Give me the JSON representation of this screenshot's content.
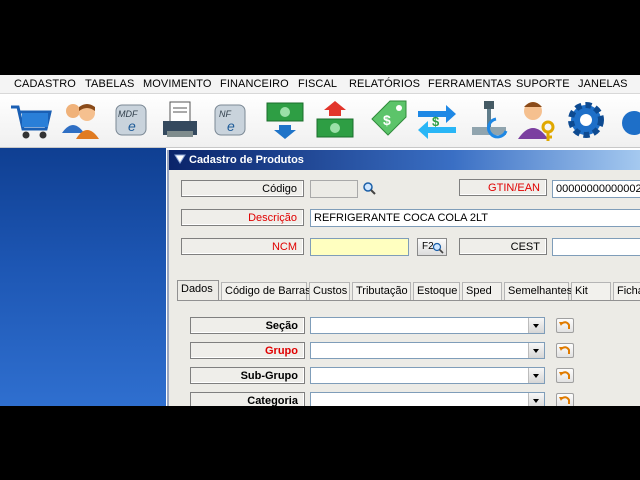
{
  "menu": [
    "CADASTRO",
    "TABELAS",
    "MOVIMENTO",
    "FINANCEIRO",
    "FISCAL",
    "RELATÓRIOS",
    "FERRAMENTAS",
    "SUPORTE",
    "JANELAS"
  ],
  "toolbar_icons": [
    "cart-icon",
    "users-icon",
    "mdfe-icon",
    "invoice-printer-icon",
    "nfe-icon",
    "money-in-icon",
    "money-out-icon",
    "price-tag-icon",
    "transfer-icon",
    "scale-icon",
    "user-key-icon",
    "gear-icon",
    "partial-icon"
  ],
  "window": {
    "title": "Cadastro de Produtos"
  },
  "form": {
    "codigo_label": "Código",
    "codigo_value": "",
    "gtin_label": "GTIN/EAN",
    "gtin_value": "00000000000002",
    "descricao_label": "Descrição",
    "descricao_value": "REFRIGERANTE COCA COLA 2LT",
    "ncm_label": "NCM",
    "ncm_value": "",
    "f2_label": "F2",
    "cest_label": "CEST",
    "cest_value": ""
  },
  "tabs": [
    "Dados",
    "Código de Barras",
    "Custos",
    "Tributação",
    "Estoque",
    "Sped",
    "Semelhantes",
    "Kit",
    "Ficha"
  ],
  "dados": {
    "secao_label": "Seção",
    "grupo_label": "Grupo",
    "subgrupo_label": "Sub-Grupo",
    "categoria_label": "Categoria"
  },
  "colors": {
    "required": "#e00000",
    "panel": "#1d56b3",
    "title": "#0a246a"
  }
}
